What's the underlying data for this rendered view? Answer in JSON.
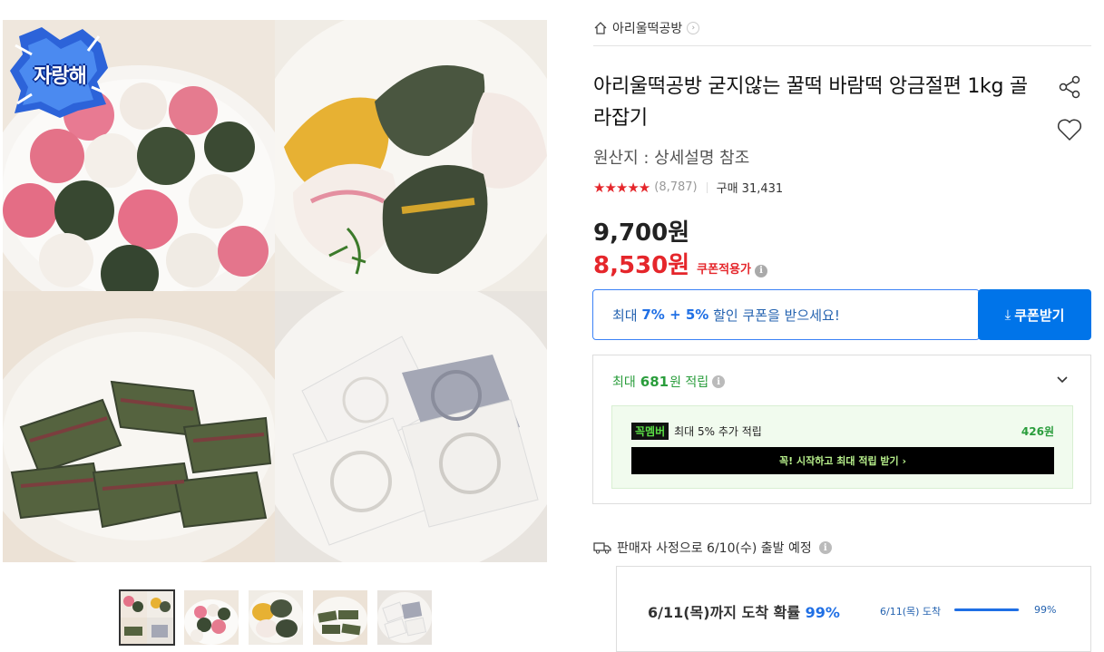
{
  "gallery": {
    "badge_text": "자랑해",
    "thumb_count": 5
  },
  "store": {
    "name": "아리울떡공방"
  },
  "product": {
    "title": "아리울떡공방 굳지않는 꿀떡 바람떡 앙금절편 1kg 골라잡기",
    "origin": "원산지 : 상세설명 참조",
    "stars": "★★★★★",
    "rating_value": 4.9,
    "review_count": "(8,787)",
    "purchase_count": "구매 31,431"
  },
  "price": {
    "original": "9,700원",
    "sale": "8,530원",
    "coupon_note": "쿠폰적용가"
  },
  "coupon": {
    "prefix": "최대 ",
    "highlight": "7% + 5%",
    "suffix": " 할인 쿠폰을 받으세요!",
    "button_label": "쿠폰받기"
  },
  "reward": {
    "prefix": "최대",
    "amount": "681",
    "suffix": "원 적립",
    "member_logo": "꼭멤버",
    "member_text": "최대 5% 추가 적립",
    "member_amount": "426원",
    "member_button": "꼭! 시작하고 최대 적립 받기 ›"
  },
  "shipping": {
    "notice": "판매자 사정으로 6/10(수) 출발 예정",
    "arrival_prefix": "6/11(목)까지 도착 확률 ",
    "arrival_pct": "99%",
    "arrival_small_label": "6/11(목) 도착",
    "arrival_small_pct": "99%",
    "arrival_fraction": 0.99
  },
  "colors": {
    "accent_red": "#e5262b",
    "accent_blue": "#0074e9",
    "green": "#2a9d3c"
  }
}
